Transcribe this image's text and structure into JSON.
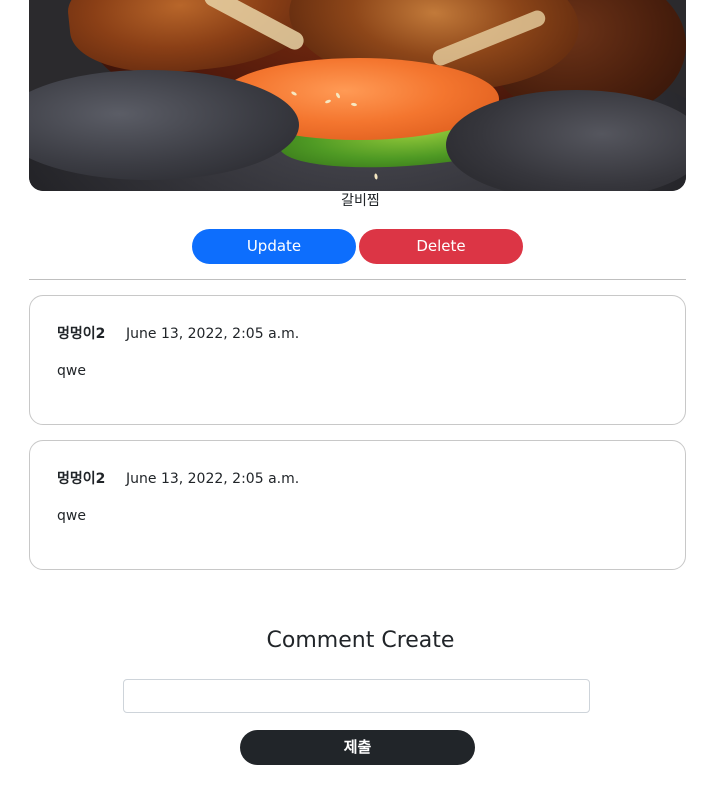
{
  "post": {
    "image_alt": "food photo",
    "caption": "갈비찜"
  },
  "actions": {
    "update_label": "Update",
    "delete_label": "Delete"
  },
  "comments": [
    {
      "author": "멍멍이2",
      "date": "June 13, 2022, 2:05 a.m.",
      "body": "qwe"
    },
    {
      "author": "멍멍이2",
      "date": "June 13, 2022, 2:05 a.m.",
      "body": "qwe"
    }
  ],
  "comment_form": {
    "title": "Comment Create",
    "input_value": "",
    "input_placeholder": "",
    "submit_label": "제출"
  },
  "colors": {
    "update": "#0d6efd",
    "delete": "#dc3545",
    "submit": "#212529"
  }
}
